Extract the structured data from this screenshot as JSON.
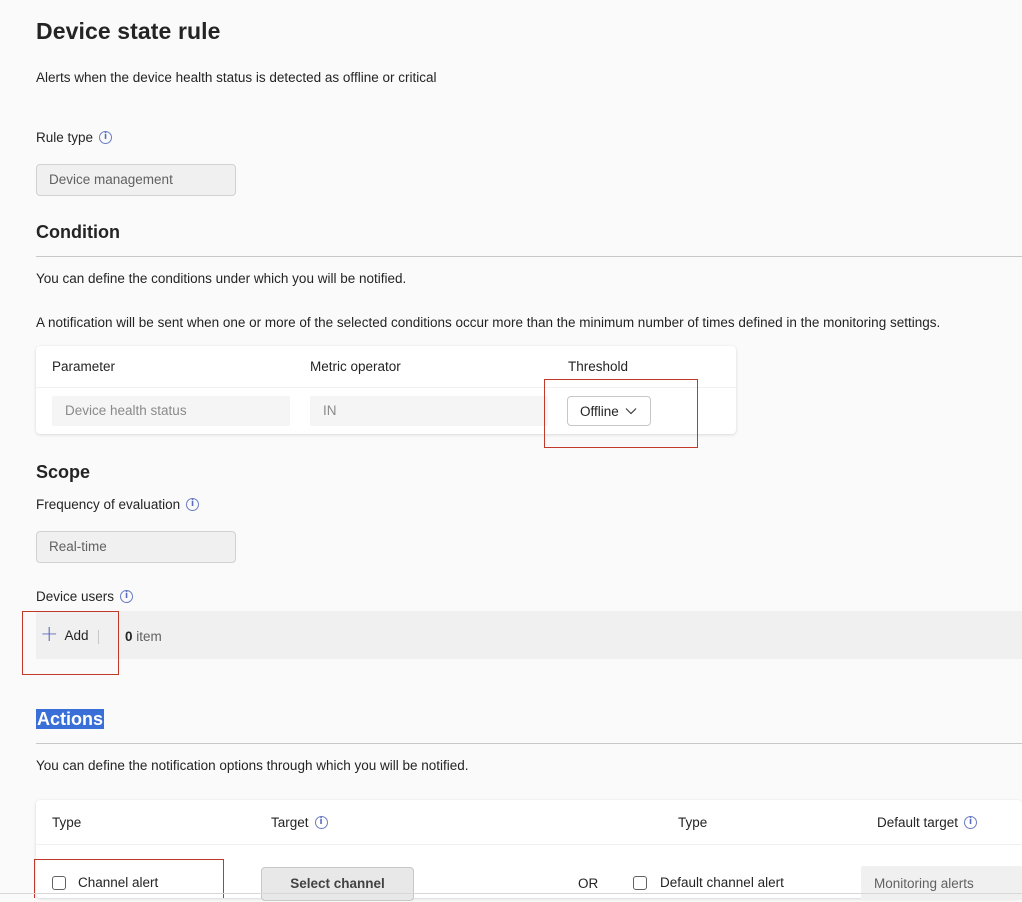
{
  "page": {
    "title": "Device state rule",
    "description": "Alerts when the device health status is detected as offline or critical"
  },
  "rule_type": {
    "label": "Rule type",
    "value": "Device management"
  },
  "condition": {
    "heading": "Condition",
    "description1": "You can define the conditions under which you will be notified.",
    "description2": "A notification will be sent when one or more of the selected conditions occur more than the minimum number of times defined in the monitoring settings.",
    "columns": [
      "Parameter",
      "Metric operator",
      "Threshold"
    ],
    "row": {
      "parameter": "Device health status",
      "operator": "IN",
      "threshold": "Offline"
    }
  },
  "scope": {
    "heading": "Scope",
    "frequency_label": "Frequency of evaluation",
    "frequency_value": "Real-time",
    "device_users_label": "Device users",
    "add_label": "Add",
    "item_count": "0",
    "item_unit": "item"
  },
  "actions": {
    "heading": "Actions",
    "description": "You can define the notification options through which you will be notified.",
    "columns": [
      "Type",
      "Target",
      "Type",
      "Default target"
    ],
    "row": {
      "channel_alert": "Channel alert",
      "select_channel": "Select channel",
      "or": "OR",
      "default_channel_alert": "Default channel alert",
      "default_target": "Monitoring alerts"
    }
  },
  "icons": {
    "info": "info-icon",
    "chevron": "chevron-down-icon",
    "plus": "plus-icon"
  },
  "colors": {
    "highlight_box": "#c0392b",
    "accent": "#5b6bbd",
    "selection": "#3a6fd8"
  }
}
